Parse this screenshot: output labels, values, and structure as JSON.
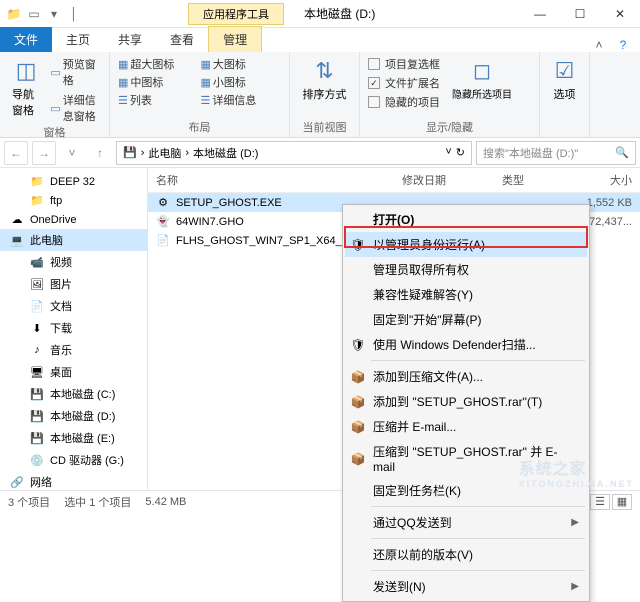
{
  "window": {
    "app_tools_label": "应用程序工具",
    "title": "本地磁盘 (D:)",
    "min_glyph": "—",
    "max_glyph": "☐",
    "close_glyph": "✕"
  },
  "tabs": {
    "file": "文件",
    "home": "主页",
    "share": "共享",
    "view": "查看",
    "manage": "管理"
  },
  "ribbon": {
    "group_pane": "窗格",
    "group_layout": "布局",
    "group_current": "当前视图",
    "group_showhide": "显示/隐藏",
    "navpane": "导航窗格",
    "preview": "预览窗格",
    "details_pane": "详细信息窗格",
    "extra_large": "超大图标",
    "large": "大图标",
    "medium": "中图标",
    "small": "小图标",
    "list": "列表",
    "details": "详细信息",
    "sort": "排序方式",
    "item_checkboxes": "项目复选框",
    "file_ext": "文件扩展名",
    "hidden_items": "隐藏的项目",
    "hide": "隐藏所选项目",
    "options": "选项"
  },
  "address": {
    "root": "此电脑",
    "loc": "本地磁盘 (D:)",
    "search_placeholder": "搜索\"本地磁盘 (D:)\""
  },
  "sidebar": [
    {
      "icon": "📁",
      "label": "DEEP 32",
      "indent": 1
    },
    {
      "icon": "📁",
      "label": "ftp",
      "indent": 1
    },
    {
      "icon": "☁",
      "label": "OneDrive",
      "indent": 0,
      "root": true
    },
    {
      "icon": "💻",
      "label": "此电脑",
      "indent": 0,
      "root": true,
      "selected": true
    },
    {
      "icon": "📹",
      "label": "视频",
      "indent": 1
    },
    {
      "icon": "🖼",
      "label": "图片",
      "indent": 1
    },
    {
      "icon": "📄",
      "label": "文档",
      "indent": 1
    },
    {
      "icon": "⬇",
      "label": "下载",
      "indent": 1
    },
    {
      "icon": "♪",
      "label": "音乐",
      "indent": 1
    },
    {
      "icon": "🖥",
      "label": "桌面",
      "indent": 1
    },
    {
      "icon": "💾",
      "label": "本地磁盘 (C:)",
      "indent": 1
    },
    {
      "icon": "💾",
      "label": "本地磁盘 (D:)",
      "indent": 1
    },
    {
      "icon": "💾",
      "label": "本地磁盘 (E:)",
      "indent": 1
    },
    {
      "icon": "💿",
      "label": "CD 驱动器 (G:)",
      "indent": 1
    },
    {
      "icon": "🔗",
      "label": "网络",
      "indent": 0,
      "root": true
    }
  ],
  "columns": {
    "name": "名称",
    "date": "修改日期",
    "type": "类型",
    "size": "大小"
  },
  "files": [
    {
      "icon": "⚙",
      "name": "SETUP_GHOST.EXE",
      "size": "1,552 KB",
      "selected": true
    },
    {
      "icon": "👻",
      "name": "64WIN7.GHO",
      "size": "72,437..."
    },
    {
      "icon": "📄",
      "name": "FLHS_GHOST_WIN7_SP1_X64_V...",
      "size": ""
    }
  ],
  "context_menu": [
    {
      "label": "打开(O)",
      "bold": true
    },
    {
      "label": "以管理员身份运行(A)",
      "icon": "🛡",
      "highlighted": true
    },
    {
      "label": "管理员取得所有权"
    },
    {
      "label": "兼容性疑难解答(Y)"
    },
    {
      "label": "固定到\"开始\"屏幕(P)"
    },
    {
      "label": "使用 Windows Defender扫描...",
      "icon": "🛡"
    },
    {
      "sep": true
    },
    {
      "label": "添加到压缩文件(A)...",
      "icon": "📦"
    },
    {
      "label": "添加到 \"SETUP_GHOST.rar\"(T)",
      "icon": "📦"
    },
    {
      "label": "压缩并 E-mail...",
      "icon": "📦"
    },
    {
      "label": "压缩到 \"SETUP_GHOST.rar\" 并 E-mail",
      "icon": "📦"
    },
    {
      "label": "固定到任务栏(K)"
    },
    {
      "sep": true
    },
    {
      "label": "通过QQ发送到",
      "arrow": true
    },
    {
      "sep": true
    },
    {
      "label": "还原以前的版本(V)"
    },
    {
      "sep": true
    },
    {
      "label": "发送到(N)",
      "arrow": true
    }
  ],
  "status": {
    "count": "3 个项目",
    "selected": "选中 1 个项目",
    "size": "5.42 MB"
  },
  "watermark": {
    "main": "系统之家",
    "sub": "XITONGZHIJIA.NET"
  }
}
